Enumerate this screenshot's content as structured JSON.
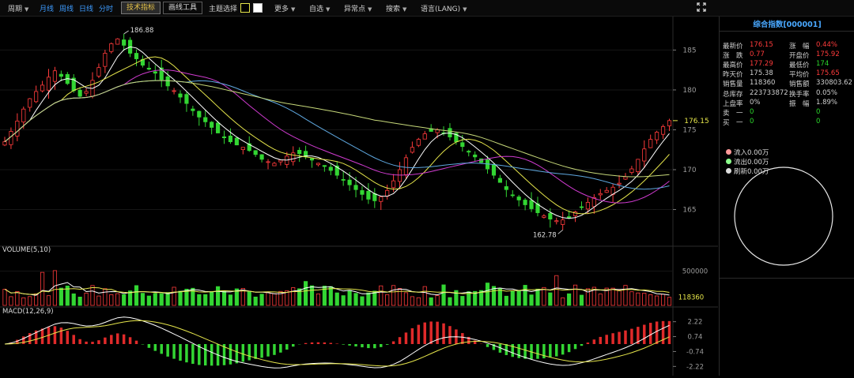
{
  "toolbar": {
    "period": "周期",
    "month": "月线",
    "week": "周线",
    "day": "日线",
    "minute": "分时",
    "tech_indicator": "技术指标",
    "draw_tools": "画线工具",
    "theme": "主题选择",
    "more": "更多",
    "self_select": "自选",
    "abnormal": "异常点",
    "search": "搜索",
    "language": "语言(LANG)"
  },
  "panel": {
    "title": "综合指数[000001]",
    "rows": [
      {
        "l1": "最新价",
        "v1": "176.15",
        "c1": "red",
        "l2": "涨　幅",
        "v2": "0.44%",
        "c2": "red"
      },
      {
        "l1": "涨　跌",
        "v1": "0.77",
        "c1": "red",
        "l2": "开盘价",
        "v2": "175.92",
        "c2": "red"
      },
      {
        "l1": "最高价",
        "v1": "177.29",
        "c1": "red",
        "l2": "最低价",
        "v2": "174",
        "c2": "green"
      },
      {
        "l1": "昨天价",
        "v1": "175.38",
        "c1": "gray",
        "l2": "平均价",
        "v2": "175.65",
        "c2": "red"
      },
      {
        "l1": "销售量",
        "v1": "118360",
        "c1": "gray",
        "l2": "销售额",
        "v2": "330803.62",
        "c2": "gray"
      },
      {
        "l1": "总库存",
        "v1": "223733872",
        "c1": "gray",
        "l2": "换手率",
        "v2": "0.05%",
        "c2": "gray"
      },
      {
        "l1": "上盘率",
        "v1": "0%",
        "c1": "gray",
        "l2": "振　幅",
        "v2": "1.89%",
        "c2": "gray"
      },
      {
        "l1": "卖　一",
        "v1": "0",
        "c1": "green",
        "l2": "",
        "v2": "0",
        "c2": "green"
      },
      {
        "l1": "买　一",
        "v1": "0",
        "c1": "green",
        "l2": "",
        "v2": "0",
        "c2": "green"
      }
    ],
    "flow_in": "流入0.00万",
    "flow_out": "流出0.00万",
    "flow_net": "刷新0.00万",
    "colors": {
      "in": "#ff7a7a",
      "out": "#7dff7d",
      "net": "#dddddd"
    }
  },
  "chart_data": {
    "type": "candlestick",
    "main": {
      "y_ticks": [
        185,
        180,
        175,
        170,
        165
      ],
      "price_range": [
        160.5,
        189.0
      ],
      "current_price": "176.15",
      "high_label": "186.88",
      "low_label": "162.78",
      "ma_colors": [
        "#ffffff",
        "#e5e54b",
        "#d03bd0",
        "#5fa8e0",
        "#c7d97a"
      ]
    },
    "volume": {
      "title": "VOLUME(5,10)",
      "tick": "500000",
      "current": "118360"
    },
    "macd": {
      "title": "MACD(12,26,9)",
      "ticks": [
        "2.22",
        "0.74",
        "-0.74",
        "-2.22"
      ]
    },
    "closes": [
      173.5,
      174.8,
      176.1,
      177.6,
      178.9,
      179.8,
      180.6,
      181.6,
      182.4,
      181.7,
      180.8,
      179.9,
      179.2,
      179.8,
      181.2,
      182.8,
      184.6,
      185.8,
      186.4,
      185.6,
      184.6,
      183.9,
      183.1,
      182.6,
      182.1,
      181.3,
      180.5,
      179.9,
      179.1,
      178.3,
      177.4,
      176.6,
      176.0,
      175.3,
      174.6,
      174.0,
      173.5,
      173.1,
      172.8,
      172.4,
      171.9,
      171.3,
      171.0,
      170.8,
      171.2,
      171.7,
      172.1,
      172.0,
      171.6,
      171.2,
      170.8,
      170.4,
      169.9,
      169.3,
      168.7,
      168.1,
      167.5,
      166.9,
      166.3,
      166.1,
      166.6,
      167.4,
      168.6,
      170.0,
      171.5,
      172.8,
      173.8,
      174.5,
      174.8,
      175.0,
      174.6,
      174.1,
      173.5,
      172.9,
      172.2,
      171.6,
      170.9,
      170.1,
      169.3,
      168.4,
      167.5,
      166.8,
      166.2,
      165.6,
      165.1,
      164.6,
      164.2,
      163.8,
      163.6,
      163.7,
      164.1,
      164.7,
      165.3,
      165.9,
      166.5,
      167.0,
      167.4,
      167.8,
      168.3,
      169.1,
      170.1,
      171.3,
      172.6,
      173.8,
      174.7,
      175.4,
      176.15
    ]
  }
}
